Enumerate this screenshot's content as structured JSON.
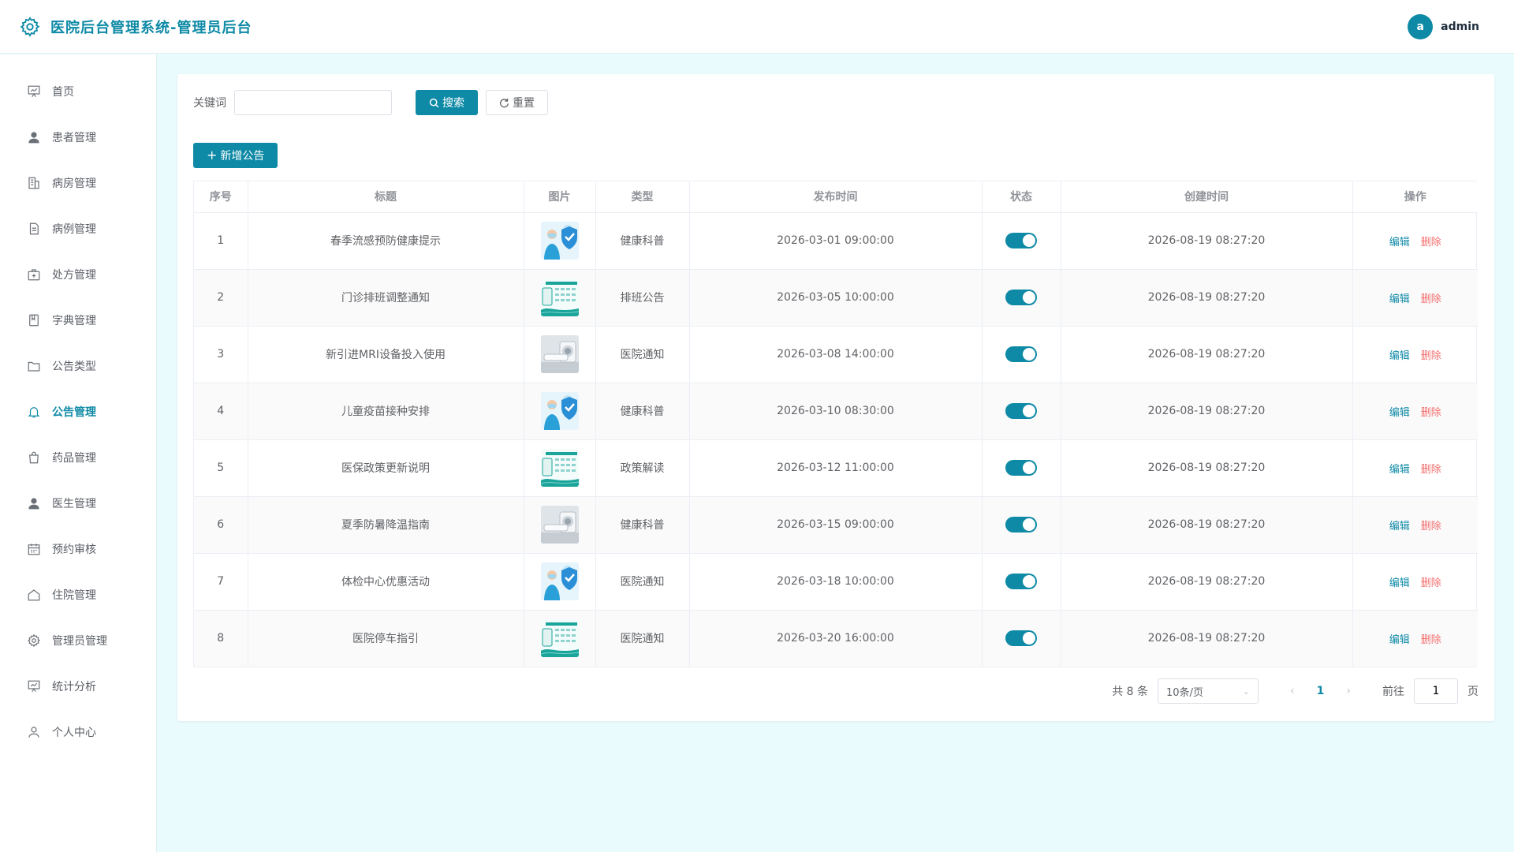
{
  "header": {
    "title": "医院后台管理系统-管理员后台",
    "avatar_letter": "a",
    "username": "admin"
  },
  "sidebar": {
    "items": [
      {
        "label": "首页",
        "icon": "chart-board-icon"
      },
      {
        "label": "患者管理",
        "icon": "user-icon"
      },
      {
        "label": "病房管理",
        "icon": "building-icon"
      },
      {
        "label": "病例管理",
        "icon": "document-icon"
      },
      {
        "label": "处方管理",
        "icon": "medical-box-icon"
      },
      {
        "label": "字典管理",
        "icon": "notebook-icon"
      },
      {
        "label": "公告类型",
        "icon": "folder-icon"
      },
      {
        "label": "公告管理",
        "icon": "bell-icon",
        "active": true
      },
      {
        "label": "药品管理",
        "icon": "bag-icon"
      },
      {
        "label": "医生管理",
        "icon": "user-icon"
      },
      {
        "label": "预约审核",
        "icon": "calendar-icon"
      },
      {
        "label": "住院管理",
        "icon": "house-icon"
      },
      {
        "label": "管理员管理",
        "icon": "gear-icon"
      },
      {
        "label": "统计分析",
        "icon": "chart-board-icon"
      },
      {
        "label": "个人中心",
        "icon": "person-icon"
      }
    ]
  },
  "search": {
    "label": "关键词",
    "value": "",
    "placeholder": "",
    "search_btn": "搜索",
    "reset_btn": "重置"
  },
  "add_button": "新增公告",
  "table": {
    "headers": [
      "序号",
      "标题",
      "图片",
      "类型",
      "发布时间",
      "状态",
      "创建时间",
      "操作"
    ],
    "edit_label": "编辑",
    "delete_label": "删除",
    "rows": [
      {
        "no": "1",
        "title": "春季流感预防健康提示",
        "image": "shield-doctor",
        "type": "健康科普",
        "publish": "2026-03-01 09:00:00",
        "status": true,
        "created": "2026-08-19 08:27:20"
      },
      {
        "no": "2",
        "title": "门诊排班调整通知",
        "image": "calendar-schedule",
        "type": "排班公告",
        "publish": "2026-03-05 10:00:00",
        "status": true,
        "created": "2026-08-19 08:27:20"
      },
      {
        "no": "3",
        "title": "新引进MRI设备投入使用",
        "image": "mri-machine",
        "type": "医院通知",
        "publish": "2026-03-08 14:00:00",
        "status": true,
        "created": "2026-08-19 08:27:20"
      },
      {
        "no": "4",
        "title": "儿童疫苗接种安排",
        "image": "shield-doctor",
        "type": "健康科普",
        "publish": "2026-03-10 08:30:00",
        "status": true,
        "created": "2026-08-19 08:27:20"
      },
      {
        "no": "5",
        "title": "医保政策更新说明",
        "image": "calendar-schedule",
        "type": "政策解读",
        "publish": "2026-03-12 11:00:00",
        "status": true,
        "created": "2026-08-19 08:27:20"
      },
      {
        "no": "6",
        "title": "夏季防暑降温指南",
        "image": "mri-machine",
        "type": "健康科普",
        "publish": "2026-03-15 09:00:00",
        "status": true,
        "created": "2026-08-19 08:27:20"
      },
      {
        "no": "7",
        "title": "体检中心优惠活动",
        "image": "shield-doctor",
        "type": "医院通知",
        "publish": "2026-03-18 10:00:00",
        "status": true,
        "created": "2026-08-19 08:27:20"
      },
      {
        "no": "8",
        "title": "医院停车指引",
        "image": "calendar-schedule",
        "type": "医院通知",
        "publish": "2026-03-20 16:00:00",
        "status": true,
        "created": "2026-08-19 08:27:20"
      }
    ]
  },
  "pagination": {
    "total_text": "共 8 条",
    "page_size": "10条/页",
    "current_page": "1",
    "goto_label": "前往",
    "goto_value": "1",
    "page_suffix": "页"
  },
  "colors": {
    "accent": "#0e8aa6",
    "danger": "#f56c6c",
    "background": "#eafbfd"
  }
}
